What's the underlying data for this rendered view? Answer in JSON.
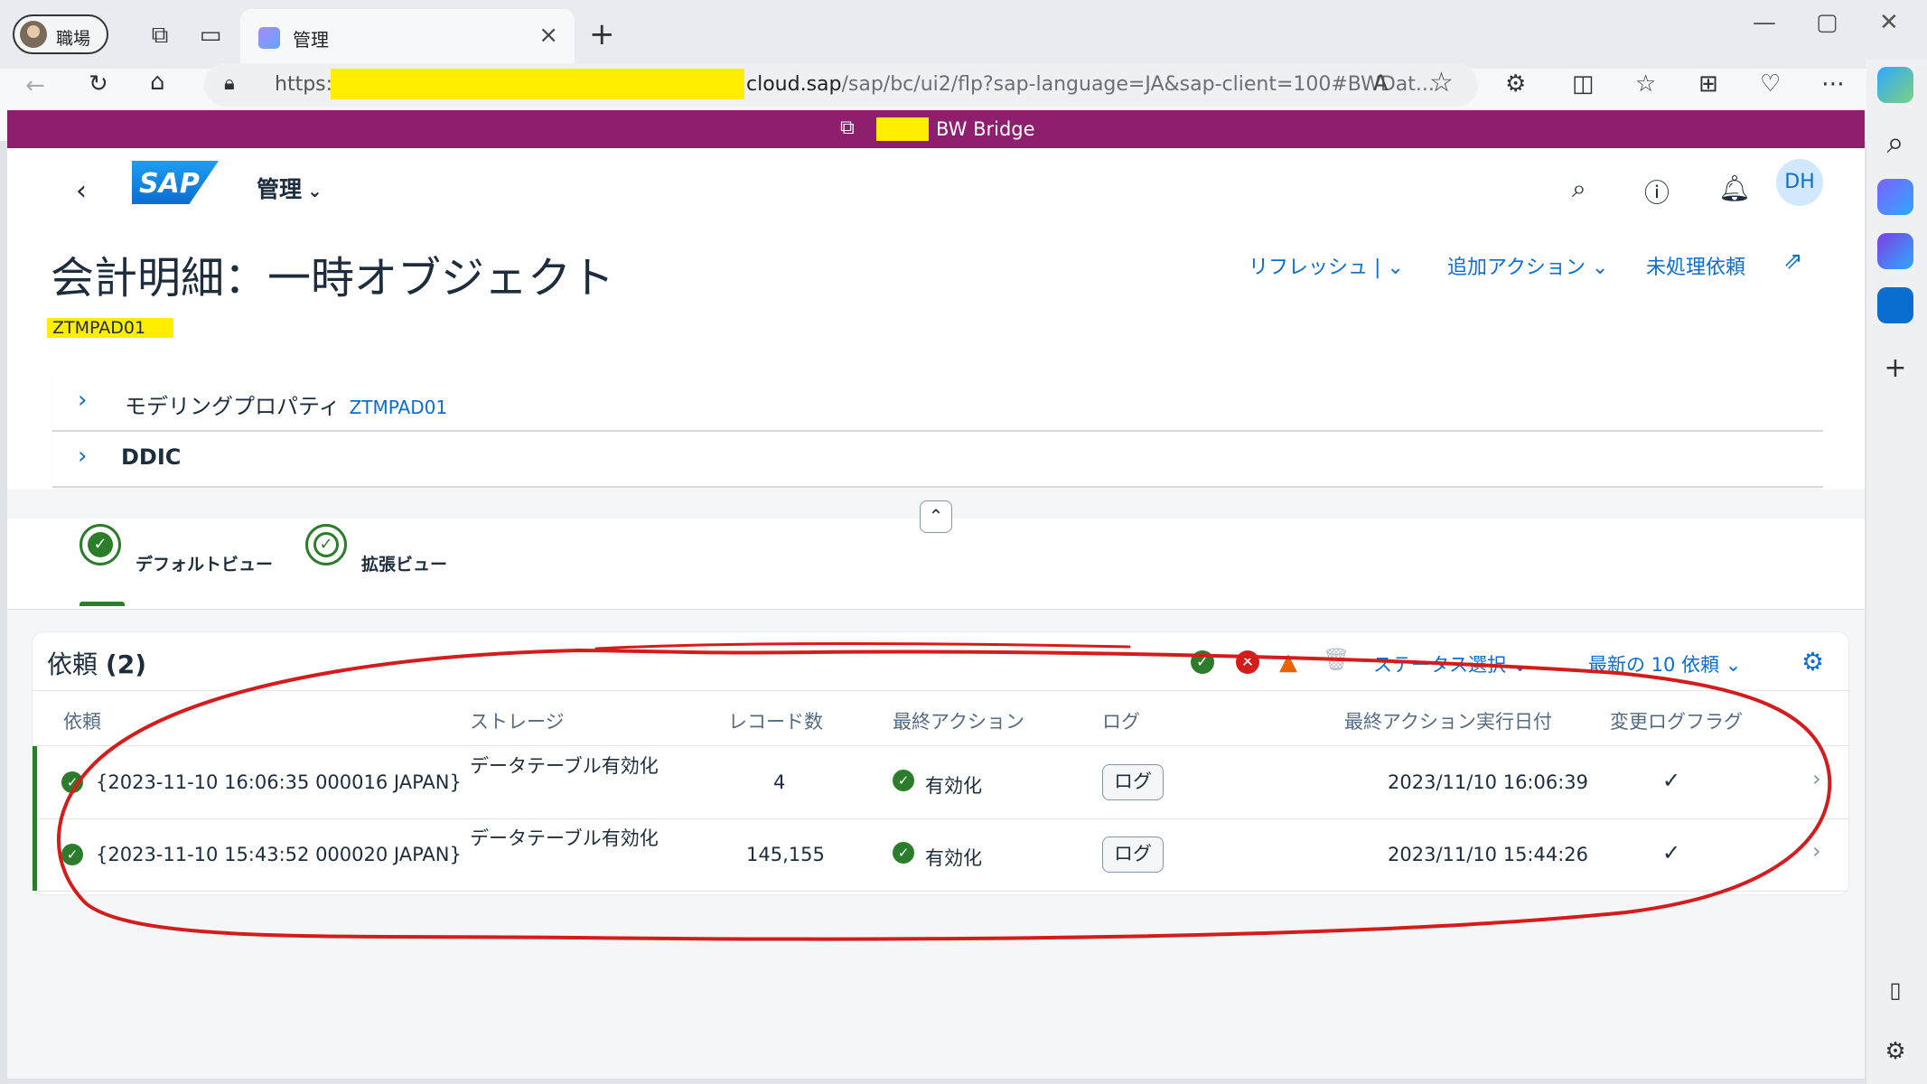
{
  "browser": {
    "profile_label": "職場",
    "tab_title": "管理",
    "url_prefix": "https://",
    "url_domain": "cloud.sap",
    "url_path": "/sap/bc/ui2/flp?sap-language=JA&sap-client=100#BWDat..."
  },
  "system_bar": {
    "label": "BW Bridge"
  },
  "shell": {
    "app_title": "管理",
    "avatar": "DH"
  },
  "header": {
    "title": "会計明細：一時オブジェクト",
    "subtitle": "ZTMPAD01",
    "actions": {
      "refresh": "リフレッシュ",
      "more": "追加アクション",
      "pending": "未処理依頼"
    }
  },
  "panels": [
    {
      "title": "モデリングプロパティ",
      "value": "ZTMPAD01"
    },
    {
      "title": "DDIC",
      "value": ""
    }
  ],
  "view_tabs": [
    {
      "label": "デフォルトビュー",
      "selected": true
    },
    {
      "label": "拡張ビュー",
      "selected": false
    }
  ],
  "requests": {
    "title_label": "依頼",
    "count": "(2)",
    "status_select": "ステータス選択",
    "latest_filter": "最新の 10 依頼",
    "columns": [
      "依頼",
      "ストレージ",
      "レコード数",
      "最終アクション",
      "ログ",
      "最終アクション実行日付",
      "変更ログフラグ"
    ],
    "rows": [
      {
        "request": "{2023-11-10 16:06:35 000016 JAPAN}",
        "storage": "データテーブル有効化",
        "records": "4",
        "action": "有効化",
        "log": "ログ",
        "date": "2023/11/10 16:06:39",
        "flag": "✓"
      },
      {
        "request": "{2023-11-10 15:43:52 000020 JAPAN}",
        "storage": "データテーブル有効化",
        "records": "145,155",
        "action": "有効化",
        "log": "ログ",
        "date": "2023/11/10 15:44:26",
        "flag": "✓"
      }
    ]
  },
  "colors": {
    "brand_bar": "#8e1f6f",
    "link": "#0a6ed1",
    "success": "#2b7c2b",
    "annotation": "#d41c1c",
    "highlight": "#ffee00"
  }
}
